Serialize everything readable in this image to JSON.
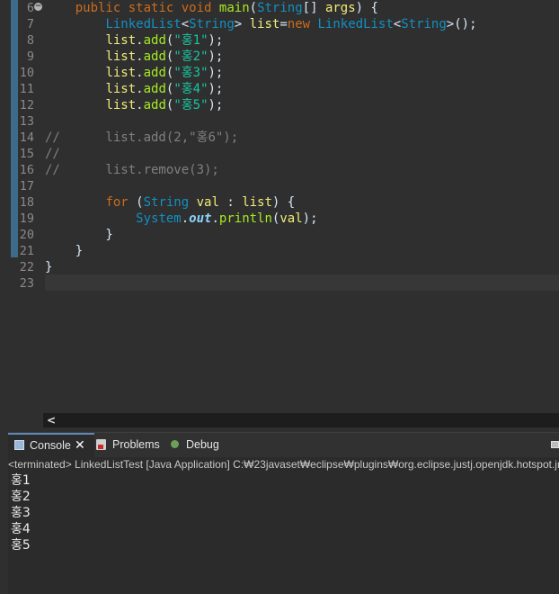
{
  "editor": {
    "line_numbers": [
      "6",
      "7",
      "8",
      "9",
      "10",
      "11",
      "12",
      "13",
      "14",
      "15",
      "16",
      "17",
      "18",
      "19",
      "20",
      "21",
      "22",
      "23"
    ],
    "code": {
      "l6": {
        "indent": "    ",
        "kw1": "public",
        "kw2": "static",
        "kw3": "void",
        "name": "main",
        "open": "(",
        "type": "String",
        "arr": "[] ",
        "param": "args",
        "close": ") {"
      },
      "l7": {
        "indent": "        ",
        "t1": "LinkedList",
        "lt1": "<",
        "t2": "String",
        "gt1": "> ",
        "v": "list",
        "eq": "=",
        "kw": "new",
        "t3": " LinkedList",
        "lt2": "<",
        "t4": "String",
        "rest": ">();"
      },
      "l8": {
        "indent": "        ",
        "v": "list",
        "dot": ".",
        "m": "add",
        "o": "(",
        "s": "\"홍1\"",
        "c": ");"
      },
      "l9": {
        "indent": "        ",
        "v": "list",
        "dot": ".",
        "m": "add",
        "o": "(",
        "s": "\"홍2\"",
        "c": ");"
      },
      "l10": {
        "indent": "        ",
        "v": "list",
        "dot": ".",
        "m": "add",
        "o": "(",
        "s": "\"홍3\"",
        "c": ");"
      },
      "l11": {
        "indent": "        ",
        "v": "list",
        "dot": ".",
        "m": "add",
        "o": "(",
        "s": "\"홍4\"",
        "c": ");"
      },
      "l12": {
        "indent": "        ",
        "v": "list",
        "dot": ".",
        "m": "add",
        "o": "(",
        "s": "\"홍5\"",
        "c": ");"
      },
      "l14": "//      list.add(2,\"홍6\");",
      "l15": "//",
      "l16": "//      list.remove(3);",
      "l18": {
        "indent": "        ",
        "kw": "for",
        "p1": " (",
        "t": "String",
        "sp": " ",
        "v": "val",
        "colon": " : ",
        "v2": "list",
        "rest": ") {"
      },
      "l19": {
        "indent": "            ",
        "t": "System",
        "dot": ".",
        "f": "out",
        "dot2": ".",
        "m": "println",
        "o": "(",
        "v": "val",
        "c": ");"
      },
      "l20": "        }",
      "l21": "    }",
      "l22": "}"
    },
    "fold_glyph": "−",
    "hscroll_left_glyph": "<"
  },
  "console": {
    "tabs": {
      "console": "Console",
      "problems": "Problems",
      "debug": "Debug"
    },
    "close_glyph": "✕",
    "process": "<terminated> LinkedListTest [Java Application] C:₩23javaset₩eclipse₩plugins₩org.eclipse.justj.openjdk.hotspot.jre",
    "output": [
      "홍1",
      "홍2",
      "홍3",
      "홍4",
      "홍5"
    ]
  },
  "colors": {
    "keyword": "#cc6c1d",
    "type": "#1290c3",
    "method": "#a7ec21",
    "variable": "#f3ec79",
    "string": "#17c6a3",
    "comment": "#808080",
    "background": "#2f2f2f"
  },
  "icons": [
    "fold-collapse-icon",
    "console-icon",
    "close-icon",
    "problems-icon",
    "debug-icon",
    "minimize-icon",
    "scroll-left-icon"
  ]
}
